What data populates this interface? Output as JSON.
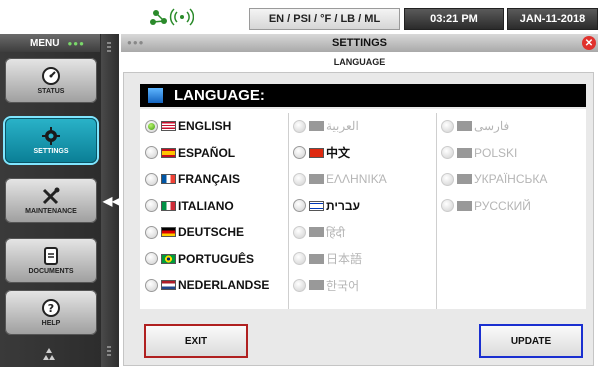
{
  "status_bar": {
    "network_icon": "network-wireless-icon",
    "units": "EN / PSI / °F / LB / ML",
    "time": "03:21 PM",
    "date": "JAN-11-2018"
  },
  "sidebar": {
    "title": "MENU",
    "items": [
      {
        "label": "STATUS",
        "icon": "gauge-icon",
        "active": false
      },
      {
        "label": "SETTINGS",
        "icon": "gear-icon",
        "active": true
      },
      {
        "label": "MAINTENANCE",
        "icon": "tools-icon",
        "active": false
      },
      {
        "label": "DOCUMENTS",
        "icon": "document-icon",
        "active": false
      },
      {
        "label": "HELP",
        "icon": "help-icon",
        "active": false
      }
    ],
    "collapse_glyph": "◀◀",
    "footer_icon": "recycle-icon"
  },
  "window": {
    "title": "SETTINGS",
    "subtitle": "LANGUAGE",
    "close_glyph": "✕"
  },
  "language_panel": {
    "header": "LANGUAGE:",
    "columns": [
      [
        {
          "label": "ENGLISH",
          "flag": "us",
          "selected": true,
          "enabled": true
        },
        {
          "label": "ESPAÑOL",
          "flag": "es",
          "selected": false,
          "enabled": true
        },
        {
          "label": "FRANÇAIS",
          "flag": "fr",
          "selected": false,
          "enabled": true
        },
        {
          "label": "ITALIANO",
          "flag": "it",
          "selected": false,
          "enabled": true
        },
        {
          "label": "DEUTSCHE",
          "flag": "de",
          "selected": false,
          "enabled": true
        },
        {
          "label": "PORTUGUÊS",
          "flag": "br",
          "selected": false,
          "enabled": true
        },
        {
          "label": "NEDERLANDSE",
          "flag": "nl",
          "selected": false,
          "enabled": true
        }
      ],
      [
        {
          "label": "العربية",
          "flag": "sa",
          "selected": false,
          "enabled": false
        },
        {
          "label": "中文",
          "flag": "cn",
          "selected": false,
          "enabled": true
        },
        {
          "label": "ΕΛΛΗΝΙΚΆ",
          "flag": "gr",
          "selected": false,
          "enabled": false
        },
        {
          "label": "עברית",
          "flag": "il",
          "selected": false,
          "enabled": true
        },
        {
          "label": "हिंदी",
          "flag": "in",
          "selected": false,
          "enabled": false
        },
        {
          "label": "日本語",
          "flag": "jp",
          "selected": false,
          "enabled": false
        },
        {
          "label": "한국어",
          "flag": "kr",
          "selected": false,
          "enabled": false
        }
      ],
      [
        {
          "label": "فارسی",
          "flag": "ir",
          "selected": false,
          "enabled": false
        },
        {
          "label": "POLSKI",
          "flag": "pl",
          "selected": false,
          "enabled": false
        },
        {
          "label": "УКРАЇНСЬКА",
          "flag": "ua",
          "selected": false,
          "enabled": false
        },
        {
          "label": "РУССКИЙ",
          "flag": "ru",
          "selected": false,
          "enabled": false
        }
      ]
    ]
  },
  "buttons": {
    "exit": "EXIT",
    "update": "UPDATE"
  },
  "colors": {
    "exit_border": "#b02020",
    "update_border": "#1a2fd0",
    "active_nav": "#1aa2ba",
    "radio_selected": "#58b81c",
    "close_button": "#e0322d"
  }
}
